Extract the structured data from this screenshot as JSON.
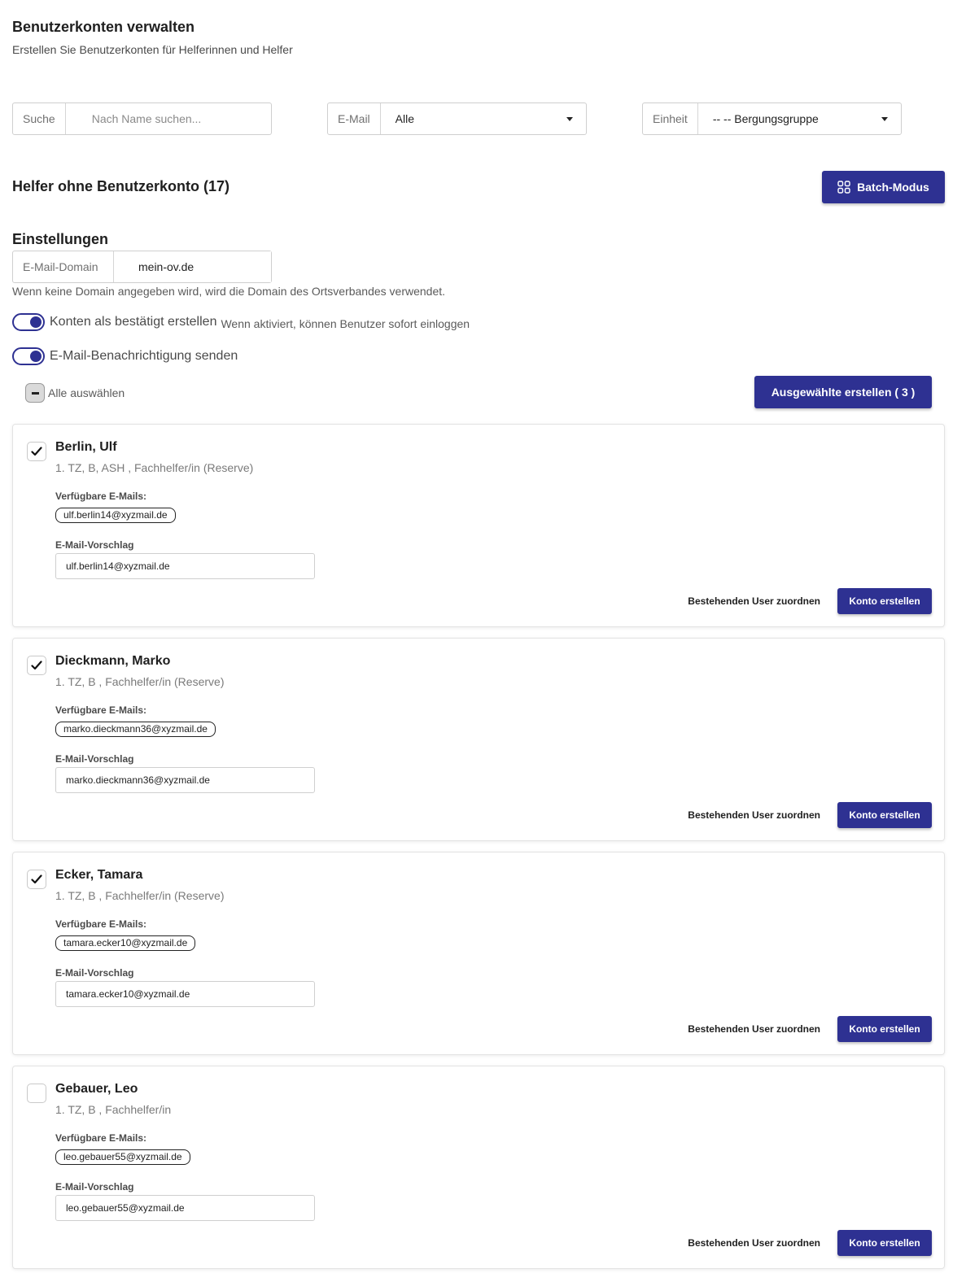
{
  "header": {
    "title": "Benutzerkonten verwalten",
    "subtitle": "Erstellen Sie Benutzerkonten für Helferinnen und Helfer"
  },
  "filters": {
    "search": {
      "label": "Suche",
      "placeholder": "Nach Name suchen...",
      "value": ""
    },
    "email": {
      "label": "E-Mail",
      "value": "Alle"
    },
    "unit": {
      "label": "Einheit",
      "value": "-- -- Bergungsgruppe"
    }
  },
  "section": {
    "title": "Helfer ohne Benutzerkonto (17)",
    "batch_label": "Batch-Modus"
  },
  "settings": {
    "title": "Einstellungen",
    "domain_label": "E-Mail-Domain",
    "domain_value": "mein-ov.de",
    "domain_hint": "Wenn keine Domain angegeben wird, wird die Domain des Ortsverbandes verwendet.",
    "confirm_label": "Konten als bestätigt erstellen",
    "confirm_hint": "Wenn aktiviert, können Benutzer sofort einloggen",
    "confirm_on": true,
    "notify_label": "E-Mail-Benachrichtigung senden",
    "notify_on": true
  },
  "selection": {
    "select_all_label": "Alle auswählen",
    "create_selected_label": "Ausgewählte erstellen ( 3 )"
  },
  "labels": {
    "available_emails": "Verfügbare E-Mails:",
    "email_suggestion": "E-Mail-Vorschlag",
    "assign_existing": "Bestehenden User zuordnen",
    "create_account": "Konto erstellen"
  },
  "helpers": [
    {
      "name": "Berlin, Ulf",
      "meta": "1. TZ, B, ASH , Fachhelfer/in (Reserve)",
      "email": "ulf.berlin14@xyzmail.de",
      "suggestion": "ulf.berlin14@xyzmail.de",
      "checked": true
    },
    {
      "name": "Dieckmann, Marko",
      "meta": "1. TZ, B , Fachhelfer/in (Reserve)",
      "email": "marko.dieckmann36@xyzmail.de",
      "suggestion": "marko.dieckmann36@xyzmail.de",
      "checked": true
    },
    {
      "name": "Ecker, Tamara",
      "meta": "1. TZ, B , Fachhelfer/in (Reserve)",
      "email": "tamara.ecker10@xyzmail.de",
      "suggestion": "tamara.ecker10@xyzmail.de",
      "checked": true
    },
    {
      "name": "Gebauer, Leo",
      "meta": "1. TZ, B , Fachhelfer/in",
      "email": "leo.gebauer55@xyzmail.de",
      "suggestion": "leo.gebauer55@xyzmail.de",
      "checked": false
    }
  ],
  "colors": {
    "primary": "#2e3192",
    "border": "#cfcfcf"
  }
}
